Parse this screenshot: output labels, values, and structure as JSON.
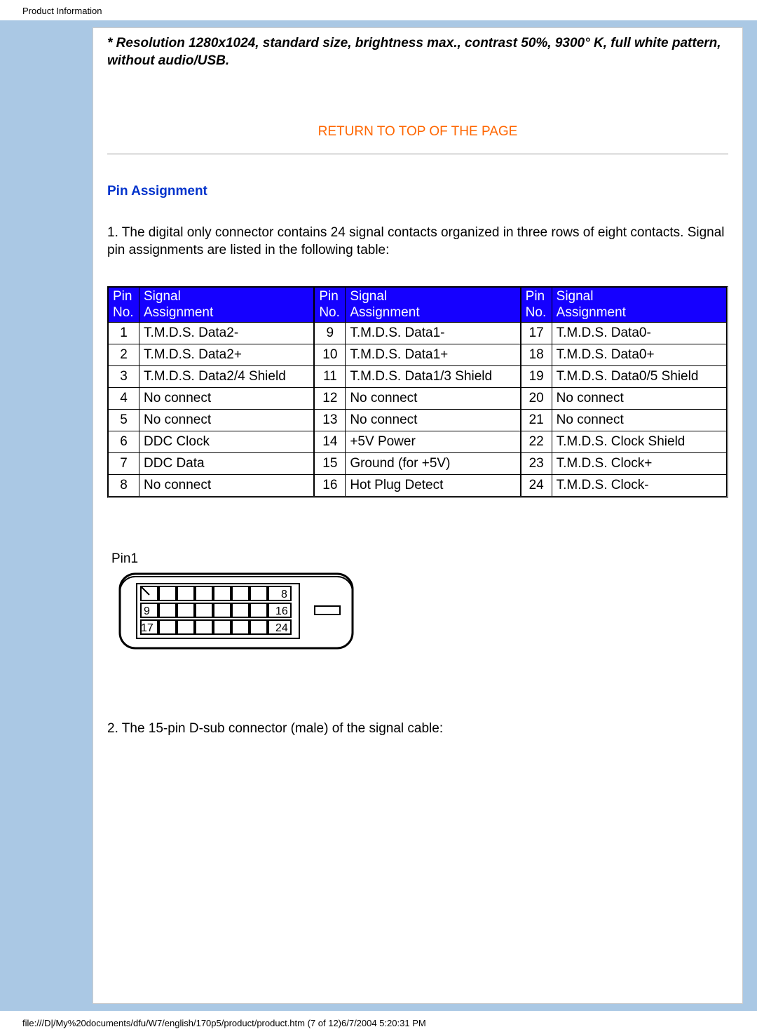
{
  "header": "Product Information",
  "note": "* Resolution 1280x1024, standard size, brightness max., contrast 50%, 9300° K, full white pattern, without audio/USB.",
  "return_link": "RETURN TO TOP OF THE PAGE",
  "section_title": "Pin Assignment",
  "intro_text": "1. The digital only connector contains 24 signal contacts organized in three rows of eight contacts. Signal pin assignments are listed in the following table:",
  "table_headers": {
    "pin_no": "Pin No.",
    "signal": "Signal Assignment"
  },
  "pins_col1": [
    {
      "n": "1",
      "s": "T.M.D.S. Data2-"
    },
    {
      "n": "2",
      "s": "T.M.D.S. Data2+"
    },
    {
      "n": "3",
      "s": "T.M.D.S. Data2/4 Shield"
    },
    {
      "n": "4",
      "s": "No connect"
    },
    {
      "n": "5",
      "s": "No connect"
    },
    {
      "n": "6",
      "s": "DDC Clock"
    },
    {
      "n": "7",
      "s": "DDC Data"
    },
    {
      "n": "8",
      "s": "No connect"
    }
  ],
  "pins_col2": [
    {
      "n": "9",
      "s": "T.M.D.S. Data1-"
    },
    {
      "n": "10",
      "s": "T.M.D.S. Data1+"
    },
    {
      "n": "11",
      "s": "T.M.D.S. Data1/3 Shield"
    },
    {
      "n": "12",
      "s": "No connect"
    },
    {
      "n": "13",
      "s": "No connect"
    },
    {
      "n": "14",
      "s": "+5V Power"
    },
    {
      "n": "15",
      "s": "Ground (for +5V)"
    },
    {
      "n": "16",
      "s": "Hot Plug Detect"
    }
  ],
  "pins_col3": [
    {
      "n": "17",
      "s": "T.M.D.S. Data0-"
    },
    {
      "n": "18",
      "s": "T.M.D.S. Data0+"
    },
    {
      "n": "19",
      "s": "T.M.D.S. Data0/5 Shield"
    },
    {
      "n": "20",
      "s": "No connect"
    },
    {
      "n": "21",
      "s": "No connect"
    },
    {
      "n": "22",
      "s": "T.M.D.S. Clock Shield"
    },
    {
      "n": "23",
      "s": "T.M.D.S. Clock+"
    },
    {
      "n": "24",
      "s": "T.M.D.S. Clock-"
    }
  ],
  "diagram": {
    "pin1_label": "Pin1",
    "labels": {
      "r1": "8",
      "r2a": "9",
      "r2b": "16",
      "r3a": "17",
      "r3b": "24"
    }
  },
  "outro_text": "2. The 15-pin D-sub connector (male) of the signal cable:",
  "footer": "file:///D|/My%20documents/dfu/W7/english/170p5/product/product.htm (7 of 12)6/7/2004 5:20:31 PM"
}
